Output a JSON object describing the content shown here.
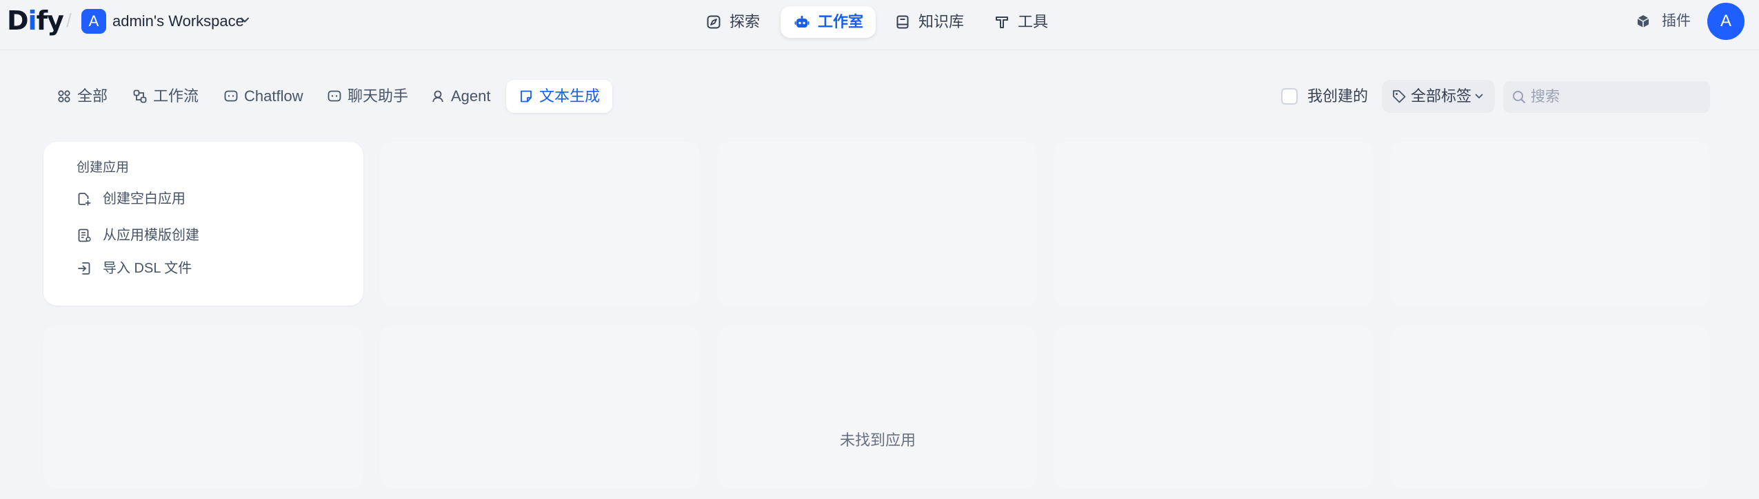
{
  "brand": {
    "logo_text": "Dify"
  },
  "workspace": {
    "avatar_letter": "A",
    "name": "admin's Workspace"
  },
  "nav": {
    "items": [
      {
        "label": "探索",
        "icon": "explore-icon"
      },
      {
        "label": "工作室",
        "icon": "robot-icon",
        "active": true
      },
      {
        "label": "知识库",
        "icon": "book-icon"
      },
      {
        "label": "工具",
        "icon": "tool-icon"
      }
    ]
  },
  "header_right": {
    "plugins_label": "插件",
    "user_avatar_letter": "A"
  },
  "filters": {
    "tabs": [
      {
        "label": "全部",
        "icon": "grid-icon"
      },
      {
        "label": "工作流",
        "icon": "workflow-icon"
      },
      {
        "label": "Chatflow",
        "icon": "chat-bubble-icon"
      },
      {
        "label": "聊天助手",
        "icon": "chat-assistant-icon"
      },
      {
        "label": "Agent",
        "icon": "agent-icon"
      },
      {
        "label": "文本生成",
        "icon": "note-icon",
        "active": true
      }
    ],
    "created_by_me_label": "我创建的",
    "created_by_me_checked": false,
    "tag_filter_label": "全部标签",
    "search_placeholder": "搜索",
    "search_value": ""
  },
  "create_card": {
    "title": "创建应用",
    "options": [
      {
        "label": "创建空白应用",
        "icon": "file-plus-icon"
      },
      {
        "label": "从应用模版创建",
        "icon": "file-template-icon"
      },
      {
        "label": "导入 DSL 文件",
        "icon": "import-icon"
      }
    ]
  },
  "empty_state": {
    "message": "未找到应用"
  },
  "colors": {
    "accent": "#155eef",
    "page_background": "#f2f4f7",
    "avatar_blue": "#1f5eff",
    "placeholder_card": "#f5f6f8"
  }
}
